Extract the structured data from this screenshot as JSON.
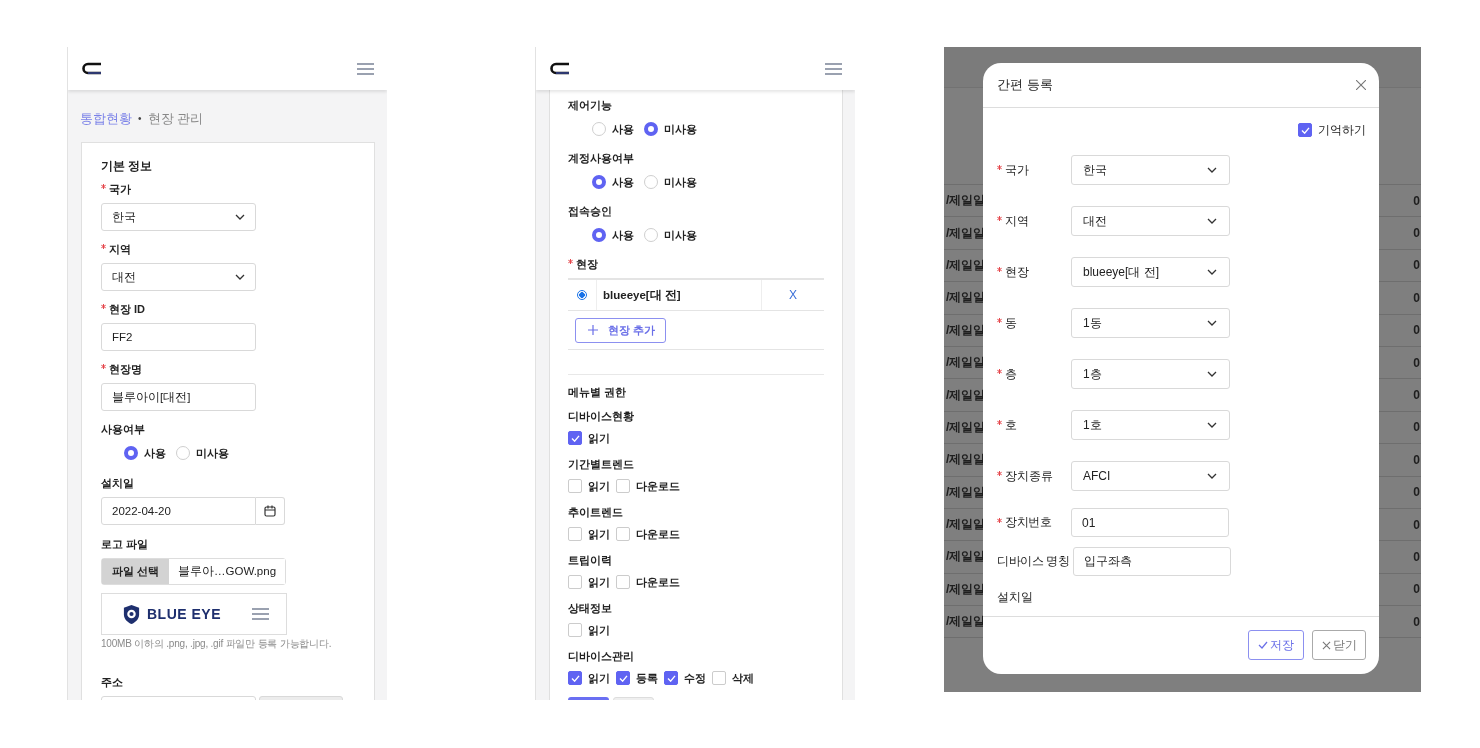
{
  "site_form": {
    "breadcrumb": {
      "link": "통합현황",
      "separator": "•",
      "current": "현장 관리"
    },
    "section_title": "기본 정보",
    "fields": [
      {
        "kind": "select",
        "label": "국가",
        "required": true,
        "value": "한국"
      },
      {
        "kind": "select",
        "label": "지역",
        "required": true,
        "value": "대전"
      },
      {
        "kind": "input",
        "label": "현장 ID",
        "required": true,
        "value": "FF2"
      },
      {
        "kind": "input",
        "label": "현장명",
        "required": true,
        "value": "블루아이[대전]"
      },
      {
        "kind": "radio",
        "label": "사용여부",
        "required": false,
        "options": [
          {
            "label": "사용",
            "selected": true
          },
          {
            "label": "미사용",
            "selected": false
          }
        ]
      },
      {
        "kind": "date",
        "label": "설치일",
        "required": false,
        "value": "2022-04-20"
      },
      {
        "kind": "file",
        "label": "로고 파일",
        "required": false,
        "button": "파일 선택",
        "value": "블루아…GOW.png",
        "preview_text": "BLUE EYE",
        "help": "100MB 이하의 .png, .jpg, .gif 파일만 등록 가능합니다."
      },
      {
        "kind": "address",
        "label": "주소",
        "required": false
      }
    ]
  },
  "account_form": {
    "settings": [
      {
        "label": "제어기능",
        "options": [
          {
            "label": "사용",
            "selected": false
          },
          {
            "label": "미사용",
            "selected": true
          }
        ]
      },
      {
        "label": "계정사용여부",
        "options": [
          {
            "label": "사용",
            "selected": true
          },
          {
            "label": "미사용",
            "selected": false
          }
        ]
      },
      {
        "label": "접속승인",
        "options": [
          {
            "label": "사용",
            "selected": true
          },
          {
            "label": "미사용",
            "selected": false
          }
        ]
      }
    ],
    "sites": {
      "label": "현장",
      "required": true,
      "rows": [
        {
          "name": "blueeye[대 전]",
          "selected": true,
          "remove": "X"
        }
      ],
      "add_button": "현장 추가"
    },
    "permissions": {
      "title": "메뉴별 권한",
      "groups": [
        {
          "label": "디바이스현황",
          "options": [
            {
              "label": "읽기",
              "checked": true
            }
          ]
        },
        {
          "label": "기간별트렌드",
          "options": [
            {
              "label": "읽기",
              "checked": false
            },
            {
              "label": "다운로드",
              "checked": false
            }
          ]
        },
        {
          "label": "추이트렌드",
          "options": [
            {
              "label": "읽기",
              "checked": false
            },
            {
              "label": "다운로드",
              "checked": false
            }
          ]
        },
        {
          "label": "트립이력",
          "options": [
            {
              "label": "읽기",
              "checked": false
            },
            {
              "label": "다운로드",
              "checked": false
            }
          ]
        },
        {
          "label": "상태정보",
          "options": [
            {
              "label": "읽기",
              "checked": false
            }
          ]
        },
        {
          "label": "디바이스관리",
          "options": [
            {
              "label": "읽기",
              "checked": true
            },
            {
              "label": "등록",
              "checked": true
            },
            {
              "label": "수정",
              "checked": true
            },
            {
              "label": "삭제",
              "checked": false
            }
          ]
        }
      ]
    }
  },
  "quick_register": {
    "background_rows": [
      {
        "column_1": "/제일일",
        "column_2": "0"
      },
      {
        "column_1": "/제일일",
        "column_2": "0"
      },
      {
        "column_1": "/제일일",
        "column_2": "0"
      },
      {
        "column_1": "/제일일",
        "column_2": "0"
      },
      {
        "column_1": "/제일일",
        "column_2": "0"
      },
      {
        "column_1": "/제일일",
        "column_2": "0"
      },
      {
        "column_1": "/제일일",
        "column_2": "0"
      },
      {
        "column_1": "/제일일",
        "column_2": "0"
      },
      {
        "column_1": "/제일일",
        "column_2": "0"
      },
      {
        "column_1": "/제일일",
        "column_2": "0"
      },
      {
        "column_1": "/제일일",
        "column_2": "0"
      },
      {
        "column_1": "/제일일",
        "column_2": "0"
      },
      {
        "column_1": "/제일일",
        "column_2": "0"
      },
      {
        "column_1": "/제일일",
        "column_2": "0"
      }
    ],
    "modal": {
      "title": "간편 등록",
      "remember": {
        "label": "기억하기",
        "checked": true
      },
      "fields": [
        {
          "kind": "select",
          "label": "국가",
          "required": true,
          "value": "한국"
        },
        {
          "kind": "select",
          "label": "지역",
          "required": true,
          "value": "대전"
        },
        {
          "kind": "select",
          "label": "현장",
          "required": true,
          "value": "blueeye[대 전]"
        },
        {
          "kind": "select",
          "label": "동",
          "required": true,
          "value": "1동"
        },
        {
          "kind": "select",
          "label": "층",
          "required": true,
          "value": "1층"
        },
        {
          "kind": "select",
          "label": "호",
          "required": true,
          "value": "1호"
        },
        {
          "kind": "select",
          "label": "장치종류",
          "required": true,
          "value": "AFCI"
        },
        {
          "kind": "input",
          "label": "장치번호",
          "required": true,
          "value": "01"
        },
        {
          "kind": "input",
          "label": "디바이스 명칭",
          "required": false,
          "value": "입구좌측"
        },
        {
          "kind": "label",
          "label": "설치일",
          "required": false
        }
      ],
      "buttons": [
        {
          "kind": "save",
          "label": "저장"
        },
        {
          "kind": "close",
          "label": "닫기"
        }
      ]
    }
  }
}
